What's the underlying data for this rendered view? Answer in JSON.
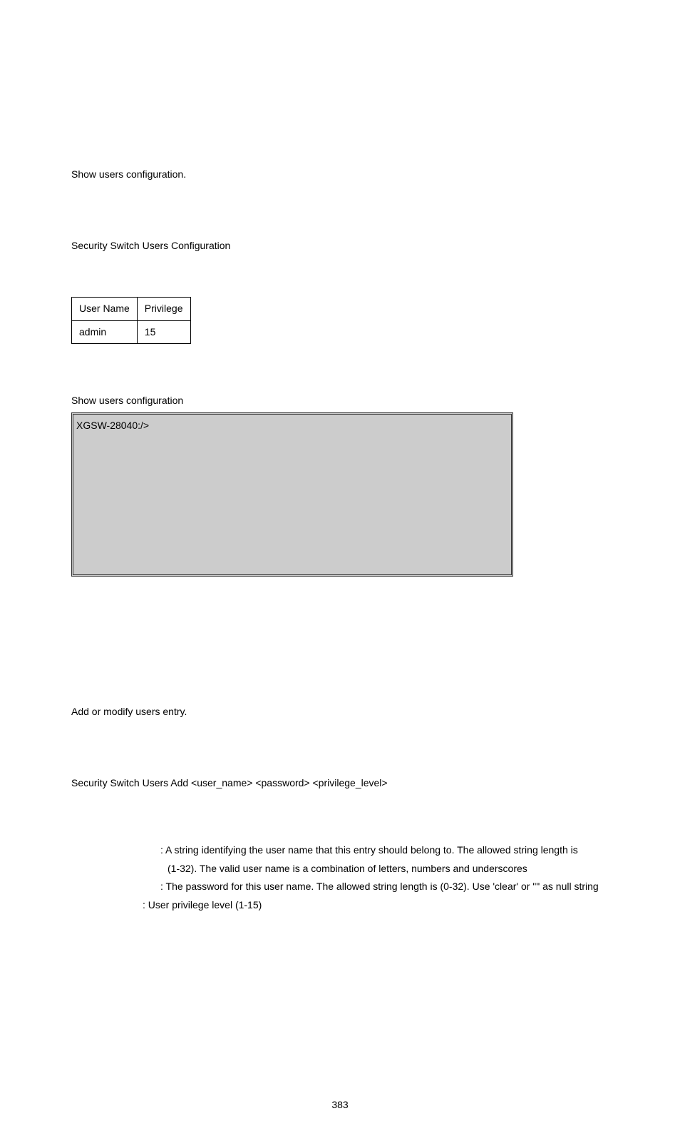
{
  "section1": {
    "description": "Show users configuration.",
    "syntax_line": "Security Switch Users Configuration",
    "table": {
      "headers": [
        "User Name",
        "Privilege"
      ],
      "rows": [
        {
          "cells": [
            "admin",
            "15"
          ]
        }
      ]
    },
    "example_caption": "Show users configuration",
    "console_prompt": "XGSW-28040:/>"
  },
  "section2": {
    "description": "Add or modify users entry.",
    "syntax_line": "Security Switch Users Add <user_name> <password> <privilege_level>",
    "params": {
      "user_name_line": ": A string identifying the user name that this entry should belong to. The allowed string length is",
      "user_name_cont": "(1-32). The valid user name is a combination of letters, numbers and underscores",
      "password_line": ": The password for this user name. The allowed string length is (0-32). Use 'clear' or \"\" as null string",
      "privilege_line": ": User privilege level (1-15)"
    }
  },
  "page_number": "383"
}
